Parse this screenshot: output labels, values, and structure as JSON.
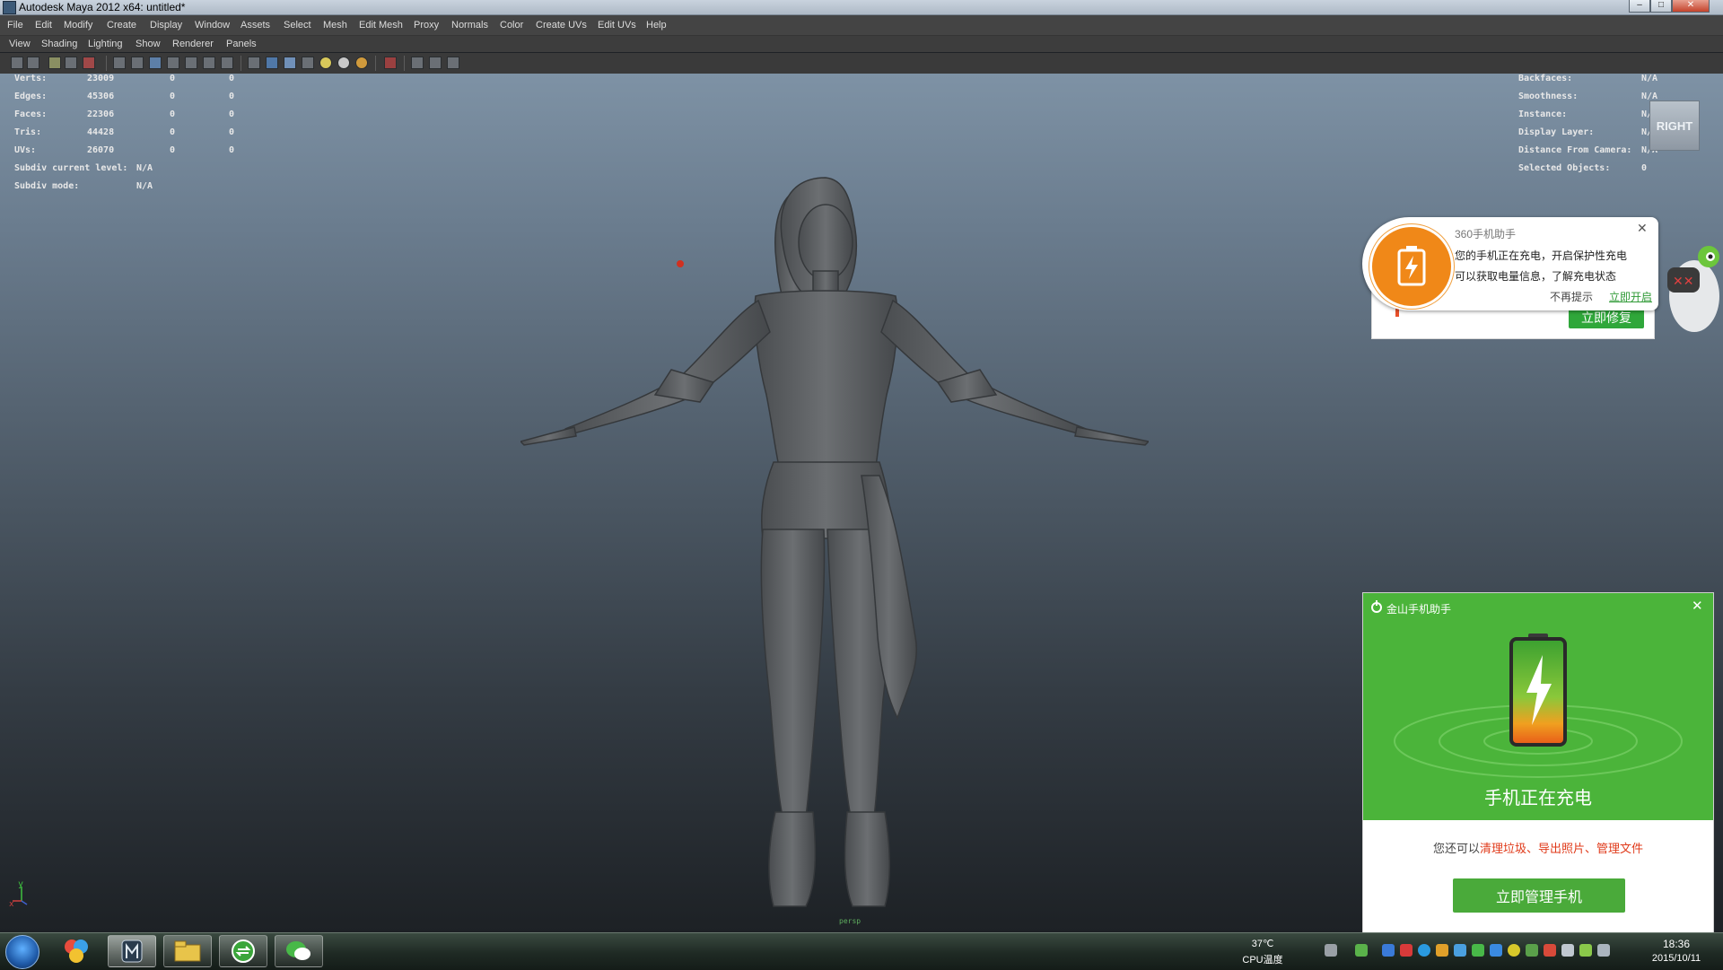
{
  "window": {
    "title": "Autodesk Maya 2012 x64: untitled*"
  },
  "menu": [
    "File",
    "Edit",
    "Modify",
    "Create",
    "Display",
    "Window",
    "Assets",
    "Select",
    "Mesh",
    "Edit Mesh",
    "Proxy",
    "Normals",
    "Color",
    "Create UVs",
    "Edit UVs",
    "Help"
  ],
  "panel_menu": [
    "View",
    "Shading",
    "Lighting",
    "Show",
    "Renderer",
    "Panels"
  ],
  "hud_left": [
    {
      "label": "Verts:",
      "a": "23009",
      "b": "0",
      "c": "0"
    },
    {
      "label": "Edges:",
      "a": "45306",
      "b": "0",
      "c": "0"
    },
    {
      "label": "Faces:",
      "a": "22306",
      "b": "0",
      "c": "0"
    },
    {
      "label": "Tris:",
      "a": "44428",
      "b": "0",
      "c": "0"
    },
    {
      "label": "UVs:",
      "a": "26070",
      "b": "0",
      "c": "0"
    }
  ],
  "hud_subdiv": [
    {
      "label": "Subdiv current level:",
      "value": "N/A"
    },
    {
      "label": "Subdiv mode:",
      "value": "N/A"
    }
  ],
  "hud_right": [
    {
      "label": "Backfaces:",
      "value": "N/A"
    },
    {
      "label": "Smoothness:",
      "value": "N/A"
    },
    {
      "label": "Instance:",
      "value": "N/A"
    },
    {
      "label": "Display Layer:",
      "value": "N/A"
    },
    {
      "label": "Distance From Camera:",
      "value": "N/A"
    },
    {
      "label": "Selected Objects:",
      "value": "0"
    }
  ],
  "view_cube": "RIGHT",
  "axis": {
    "y": "y",
    "x": "x"
  },
  "camera_label": "persp",
  "popup360": {
    "title": "360手机助手",
    "line1": "您的手机正在充电，开启保护性充电",
    "line2": "可以获取电量信息，了解充电状态",
    "dismiss": "不再提示",
    "open": "立即开启",
    "repair": "立即修复"
  },
  "kingsoft": {
    "name": "金山手机助手",
    "status": "手机正在充电",
    "tip_prefix": "您还可以",
    "tip_links": "清理垃圾、导出照片、管理文件",
    "button": "立即管理手机",
    "colors": {
      "header": "#4bb43a",
      "highlight": "#e03a1a"
    }
  },
  "taskbar": {
    "cpu_temp": "37℃",
    "cpu_label": "CPU温度",
    "time": "18:36",
    "date": "2015/10/11"
  },
  "icons": [
    "start-orb-icon",
    "media-center-icon",
    "maya-icon",
    "file-explorer-icon",
    "sync-icon",
    "wechat-icon"
  ]
}
